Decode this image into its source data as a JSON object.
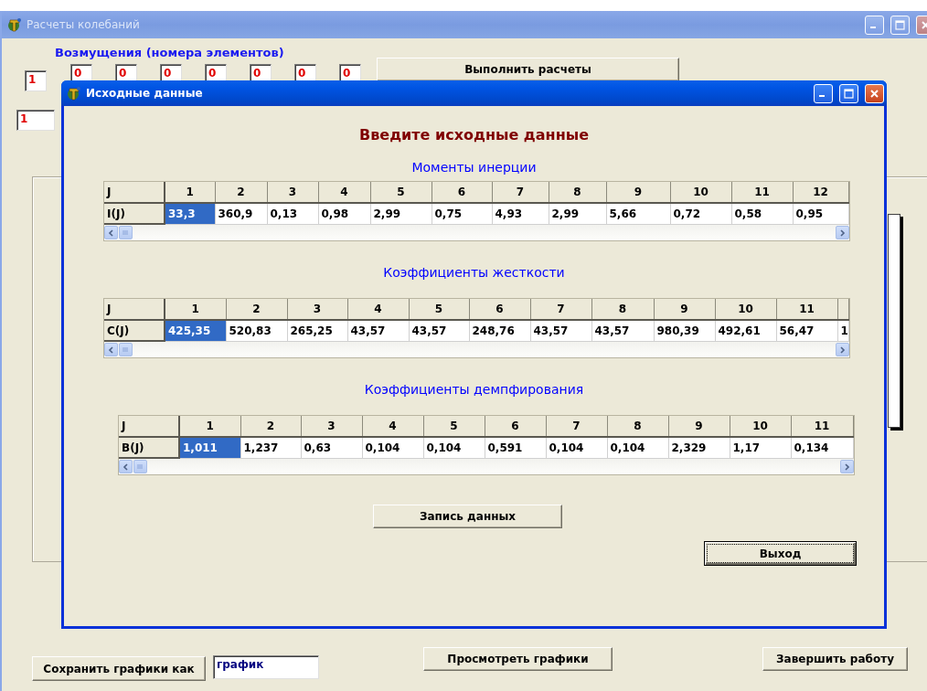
{
  "main_window": {
    "title": "Расчеты колебаний",
    "active": false,
    "disturbances_label": "Возмущения (номера элементов)",
    "disturbance_fields": [
      "1",
      "0",
      "0",
      "0",
      "0",
      "0",
      "0",
      "0"
    ],
    "run_button": "Выполнить расчеты",
    "second_field": "1",
    "save_button": "Сохранить графики как",
    "file_name_field": "график",
    "view_button": "Просмотреть графики",
    "exit_button": "Завершить работу"
  },
  "dialog": {
    "title": "Исходные данные",
    "active": true,
    "heading": "Введите исходные данные",
    "grids": [
      {
        "title": "Моменты инерции",
        "columns": [
          "J",
          "1",
          "2",
          "3",
          "4",
          "5",
          "6",
          "7",
          "8",
          "9",
          "10",
          "11",
          "12"
        ],
        "row_label": "I(J)",
        "cells": [
          {
            "text": "33,3",
            "selected": true
          },
          {
            "text": "360,9",
            "selected": false
          },
          {
            "text": "0,13",
            "selected": false
          },
          {
            "text": "0,98",
            "selected": false
          },
          {
            "text": "2,99",
            "selected": false
          },
          {
            "text": "0,75",
            "selected": false
          },
          {
            "text": "4,93",
            "selected": false
          },
          {
            "text": "2,99",
            "selected": false
          },
          {
            "text": "5,66",
            "selected": false
          },
          {
            "text": "0,72",
            "selected": false
          },
          {
            "text": "0,58",
            "selected": false
          },
          {
            "text": "0,95",
            "selected": false
          }
        ]
      },
      {
        "title": "Коэффициенты жесткости",
        "columns": [
          "J",
          "1",
          "2",
          "3",
          "4",
          "5",
          "6",
          "7",
          "8",
          "9",
          "10",
          "11",
          ""
        ],
        "row_label": "C(J)",
        "cells": [
          {
            "text": "425,35",
            "selected": true
          },
          {
            "text": "520,83",
            "selected": false
          },
          {
            "text": "265,25",
            "selected": false
          },
          {
            "text": "43,57",
            "selected": false
          },
          {
            "text": "43,57",
            "selected": false
          },
          {
            "text": "248,76",
            "selected": false
          },
          {
            "text": "43,57",
            "selected": false
          },
          {
            "text": "43,57",
            "selected": false
          },
          {
            "text": "980,39",
            "selected": false
          },
          {
            "text": "492,61",
            "selected": false
          },
          {
            "text": "56,47",
            "selected": false
          },
          {
            "text": "1",
            "selected": false
          }
        ]
      },
      {
        "title": "Коэффициенты демпфирования",
        "columns": [
          "J",
          "1",
          "2",
          "3",
          "4",
          "5",
          "6",
          "7",
          "8",
          "9",
          "10",
          "11"
        ],
        "row_label": "B(J)",
        "cells": [
          {
            "text": "1,011",
            "selected": true
          },
          {
            "text": "1,237",
            "selected": false
          },
          {
            "text": "0,63",
            "selected": false
          },
          {
            "text": "0,104",
            "selected": false
          },
          {
            "text": "0,104",
            "selected": false
          },
          {
            "text": "0,591",
            "selected": false
          },
          {
            "text": "0,104",
            "selected": false
          },
          {
            "text": "0,104",
            "selected": false
          },
          {
            "text": "2,329",
            "selected": false
          },
          {
            "text": "1,17",
            "selected": false
          },
          {
            "text": "0,134",
            "selected": false
          }
        ]
      }
    ],
    "save_button": "Запись данных",
    "exit_button": "Выход"
  }
}
